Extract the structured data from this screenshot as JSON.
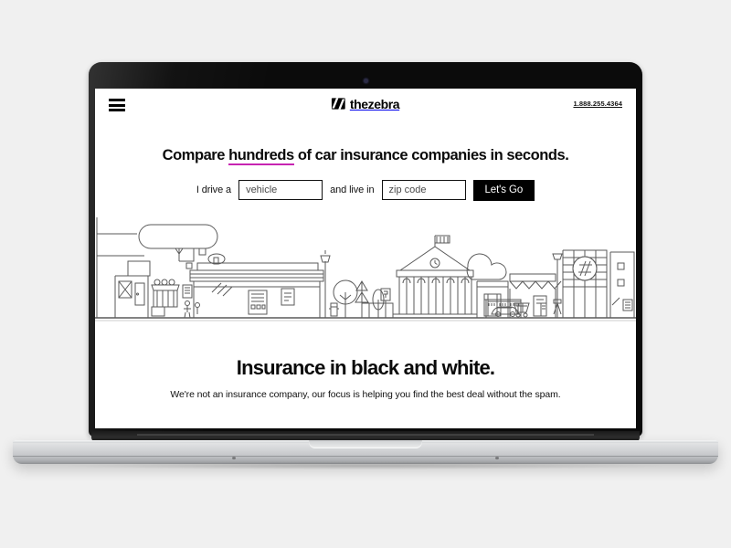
{
  "device": {
    "type": "laptop-mockup",
    "webcam": "webcam-dot"
  },
  "page": {
    "background_color": "#f0f0f0",
    "screen_background": "#ffffff",
    "accent_color": "#c724b1",
    "text_color": "#0b0b0b"
  },
  "header": {
    "menu_label": "Menu",
    "brand": {
      "logo_icon": "zebra-stripe-mark",
      "name": "thezebra"
    },
    "phone": "1.888.255.4364"
  },
  "hero": {
    "headline_before": "Compare ",
    "headline_highlight": "hundreds",
    "headline_after": " of car insurance companies in seconds.",
    "form": {
      "label_drive": "I drive a",
      "vehicle_placeholder": "vehicle",
      "vehicle_value": "",
      "label_live": "and live in",
      "zip_placeholder": "zip code",
      "zip_value": "",
      "submit_label": "Let's Go"
    }
  },
  "illustration": {
    "name": "city-skyline-line-art",
    "stroke_color": "#5a5a5a",
    "emblem": "zebra-circle-emblem"
  },
  "value_prop": {
    "title": "Insurance in black and white.",
    "subtitle": "We're not an insurance company, our focus is helping you find the best deal without the spam."
  }
}
